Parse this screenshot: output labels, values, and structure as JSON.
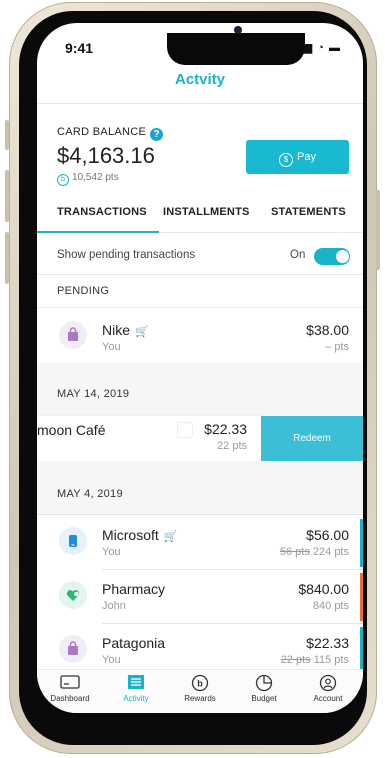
{
  "status": {
    "time": "9:41",
    "icons": "▂▄▆ ◔ ▬"
  },
  "nav": {
    "title": "Actvity"
  },
  "balance": {
    "label": "CARD BALANCE",
    "help_icon": "?",
    "amount": "$4,163.16",
    "points": "10,542 pts",
    "points_icon": "b"
  },
  "pay": {
    "label": "Pay",
    "icon": "$"
  },
  "tabs": [
    {
      "label": "TRANSACTIONS",
      "active": true
    },
    {
      "label": "INSTALLMENTS",
      "active": false
    },
    {
      "label": "STATEMENTS",
      "active": false
    }
  ],
  "pending_toggle": {
    "label": "Show pending transactions",
    "state_label": "On",
    "on": true
  },
  "sections": {
    "pending": "PENDING",
    "may14": "MAY 14, 2019",
    "may4": "MAY 4, 2019"
  },
  "transactions": {
    "nike": {
      "name": "Nike",
      "sub": "You",
      "amount": "$38.00",
      "pts": "– pts",
      "icon": "shopping-bag-icon",
      "color": "#a978c6"
    },
    "moon": {
      "name": "moon Café",
      "amount": "$22.33",
      "pts": "22 pts",
      "action": "Redeem"
    },
    "microsoft": {
      "name": "Microsoft",
      "sub": "You",
      "amount": "$56.00",
      "pts_old": "56 pts",
      "pts": "224 pts",
      "icon": "phone-icon",
      "color": "#1e8fe0"
    },
    "pharmacy": {
      "name": "Pharmacy",
      "sub": "John",
      "amount": "$840.00",
      "pts": "840 pts",
      "icon": "heart-icon",
      "color": "#2bb673"
    },
    "patagonia": {
      "name": "Patagonia",
      "sub": "You",
      "amount": "$22.33",
      "pts_old": "22 pts",
      "pts": "115 pts",
      "icon": "shopping-bag-icon",
      "color": "#a978c6"
    }
  },
  "tabbar": [
    {
      "label": "Dashboard",
      "icon": "card-icon",
      "active": false
    },
    {
      "label": "Activity",
      "icon": "list-icon",
      "active": true
    },
    {
      "label": "Rewards",
      "icon": "rewards-icon",
      "active": false
    },
    {
      "label": "Budget",
      "icon": "pie-chart-icon",
      "active": false
    },
    {
      "label": "Account",
      "icon": "user-icon",
      "active": false
    }
  ],
  "colors": {
    "accent": "#19b3c8",
    "pay": "#19b9d2",
    "redeem": "#3cbfd4",
    "orange_accent": "#f06a3c"
  }
}
